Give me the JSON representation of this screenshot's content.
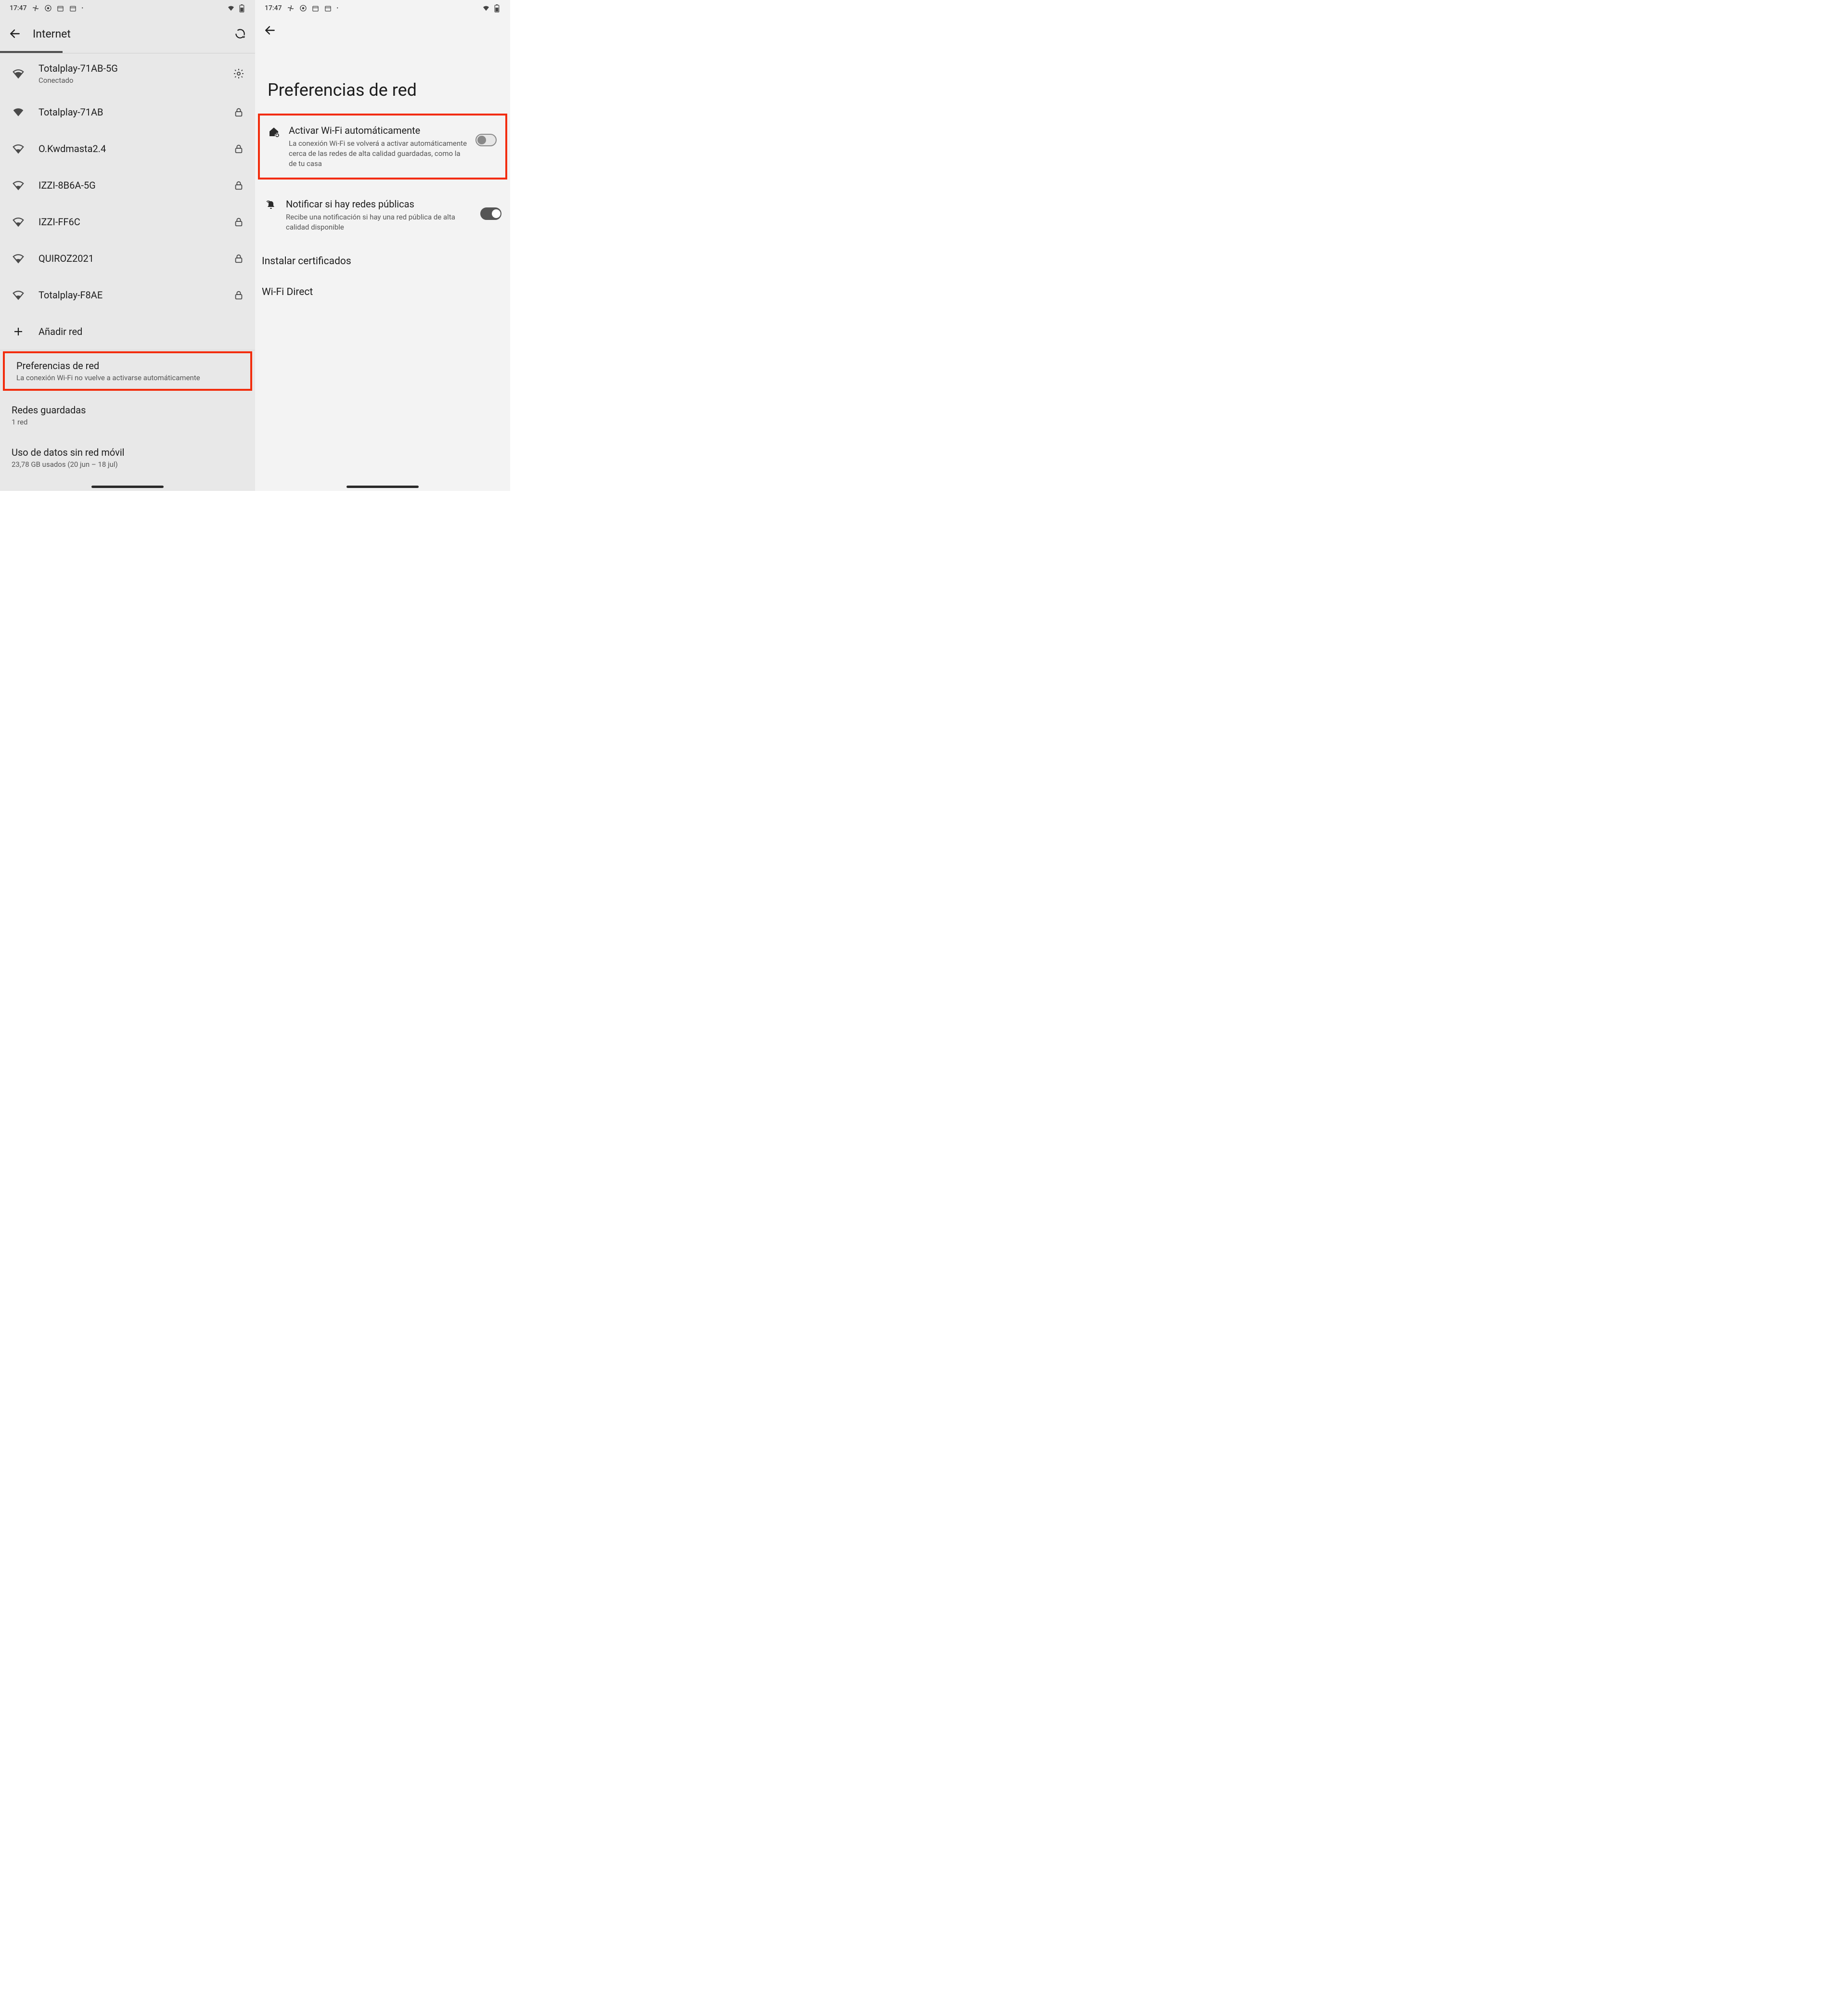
{
  "status": {
    "time": "17:47"
  },
  "left": {
    "title": "Internet",
    "networks": [
      {
        "ssid": "Totalplay-71AB-5G",
        "sub": "Conectado",
        "signal": 3,
        "connected": true
      },
      {
        "ssid": "Totalplay-71AB",
        "signal": 4,
        "locked": true
      },
      {
        "ssid": "O.Kwdmasta2.4",
        "signal": 2,
        "locked": true
      },
      {
        "ssid": "IZZI-8B6A-5G",
        "signal": 2,
        "locked": true
      },
      {
        "ssid": "IZZI-FF6C",
        "signal": 2,
        "locked": true
      },
      {
        "ssid": "QUIROZ2021",
        "signal": 2,
        "locked": true
      },
      {
        "ssid": "Totalplay-F8AE",
        "signal": 2,
        "locked": true
      }
    ],
    "add_network": "Añadir red",
    "prefs": {
      "title": "Preferencias de red",
      "sub": "La conexión Wi-Fi no vuelve a activarse automáticamente"
    },
    "saved": {
      "title": "Redes guardadas",
      "sub": "1 red"
    },
    "usage": {
      "title": "Uso de datos sin red móvil",
      "sub": "23,78 GB usados (20 jun – 18 jul)"
    }
  },
  "right": {
    "title": "Preferencias de red",
    "auto_wifi": {
      "title": "Activar Wi-Fi automáticamente",
      "sub": "La conexión Wi-Fi se volverá a activar automáticamente cerca de las redes de alta calidad guardadas, como la de tu casa",
      "on": false
    },
    "notify": {
      "title": "Notificar si hay redes públicas",
      "sub": "Recibe una notificación si hay una red pública de alta calidad disponible",
      "on": true
    },
    "certs": "Instalar certificados",
    "direct": "Wi-Fi Direct"
  }
}
